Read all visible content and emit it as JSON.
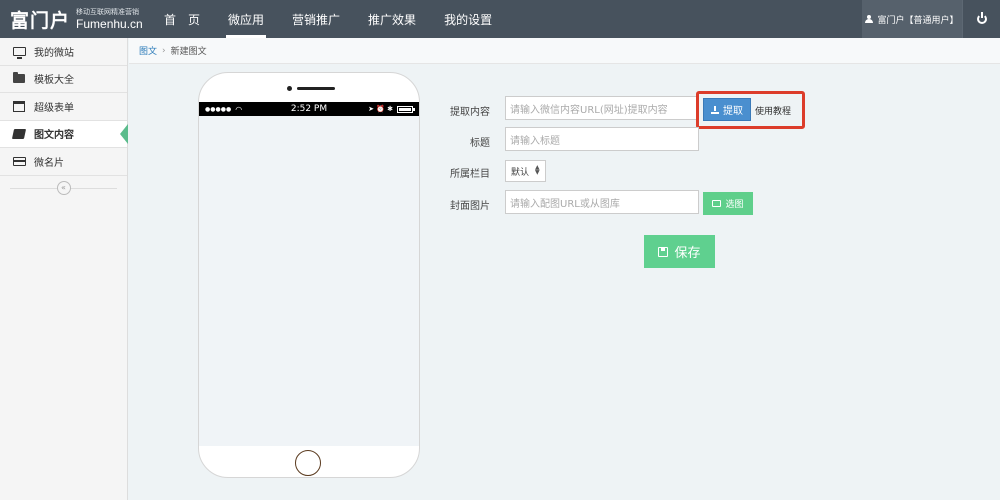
{
  "header": {
    "logo_cn": "富门户",
    "logo_sub": "移动互联网精准营销",
    "logo_en": "Fumenhu.cn",
    "nav": [
      {
        "label": "首　页",
        "active": false
      },
      {
        "label": "微应用",
        "active": true
      },
      {
        "label": "营销推广",
        "active": false
      },
      {
        "label": "推广效果",
        "active": false
      },
      {
        "label": "我的设置",
        "active": false
      }
    ],
    "user_label": "富门户【普通用户】",
    "icons": {
      "user": "user-icon",
      "power": "power-icon"
    }
  },
  "sidebar": {
    "items": [
      {
        "label": "我的微站",
        "icon": "monitor-icon"
      },
      {
        "label": "模板大全",
        "icon": "folder-icon"
      },
      {
        "label": "超级表单",
        "icon": "calendar-icon"
      },
      {
        "label": "图文内容",
        "icon": "book-icon",
        "active": true
      },
      {
        "label": "微名片",
        "icon": "card-icon"
      }
    ],
    "collapse_glyph": "«"
  },
  "breadcrumb": {
    "parent": "图文",
    "separator": "›",
    "current": "新建图文"
  },
  "phone": {
    "signal": "●●●●●",
    "time": "2:52 PM",
    "status_icons": "➤ ⏰ ✱"
  },
  "form": {
    "extract": {
      "label": "提取内容",
      "placeholder": "请输入微信内容URL(网址)提取内容",
      "button": "提取",
      "tutorial": "使用教程"
    },
    "title": {
      "label": "标题",
      "placeholder": "请输入标题"
    },
    "column": {
      "label": "所属栏目",
      "selected": "默认"
    },
    "cover": {
      "label": "封面图片",
      "placeholder": "请输入配图URL或从图库",
      "button": "选图"
    },
    "save_button": "保存"
  },
  "colors": {
    "topbar": "#47525d",
    "primary_blue": "#4a8fcf",
    "green": "#5fd08f",
    "highlight_red": "#dc3c2a"
  }
}
